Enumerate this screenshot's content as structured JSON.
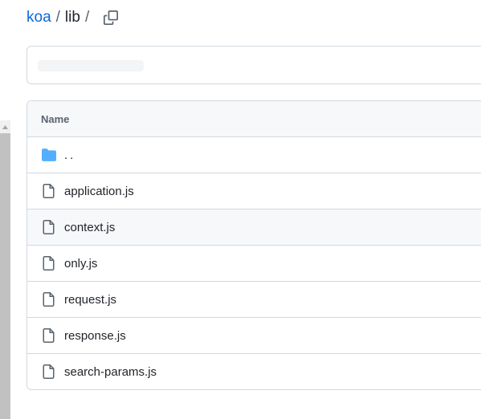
{
  "breadcrumb": {
    "repo": "koa",
    "separator": "/",
    "folder": "lib",
    "trailing_separator": "/",
    "copy_icon": "copy-icon"
  },
  "table": {
    "header_name": "Name",
    "parent_label": "..",
    "files": [
      {
        "name": "application.js",
        "icon": "file-icon"
      },
      {
        "name": "context.js",
        "icon": "file-icon"
      },
      {
        "name": "only.js",
        "icon": "file-icon"
      },
      {
        "name": "request.js",
        "icon": "file-icon"
      },
      {
        "name": "response.js",
        "icon": "file-icon"
      },
      {
        "name": "search-params.js",
        "icon": "file-icon"
      }
    ]
  },
  "colors": {
    "link": "#0969da",
    "folder_icon": "#54aeff",
    "border": "#d1d9e0",
    "header_bg": "#f6f8fa"
  }
}
